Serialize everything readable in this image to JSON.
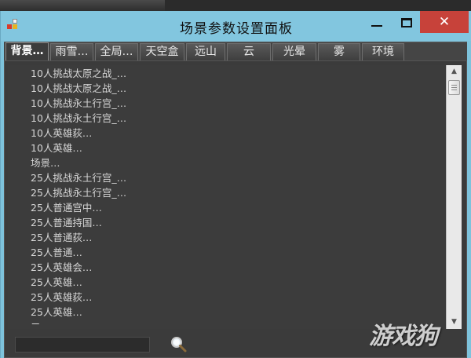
{
  "window": {
    "title": "场景参数设置面板",
    "close_glyph": "✕"
  },
  "tabs": [
    {
      "label": "背景…",
      "active": true
    },
    {
      "label": "雨雪…",
      "active": false
    },
    {
      "label": "全局…",
      "active": false
    },
    {
      "label": "天空盒",
      "active": false
    },
    {
      "label": "远山",
      "active": false
    },
    {
      "label": "云",
      "active": false
    },
    {
      "label": "光晕",
      "active": false
    },
    {
      "label": "雾",
      "active": false
    },
    {
      "label": "环境",
      "active": false
    }
  ],
  "list": {
    "items": [
      "10人挑战太原之战_…",
      "10人挑战太原之战_…",
      "10人挑战永土行宫_…",
      "10人挑战永土行宫_…",
      "10人英雄荻…",
      "10人英雄…",
      "场景…",
      "25人挑战永土行宫_…",
      "25人挑战永土行宫_…",
      "25人普通宫中…",
      "25人普通持国…",
      "25人普通荻…",
      "25人普通…",
      "25人英雄会…",
      "25人英雄…",
      "25人英雄荻…",
      "25人英雄…",
      "二…"
    ]
  },
  "search": {
    "value": "",
    "icon": "magnifier-icon"
  },
  "watermark": "游戏狗",
  "colors": {
    "titlebar": "#82c6df",
    "close": "#c7423a",
    "panel": "#3b3b3b"
  }
}
